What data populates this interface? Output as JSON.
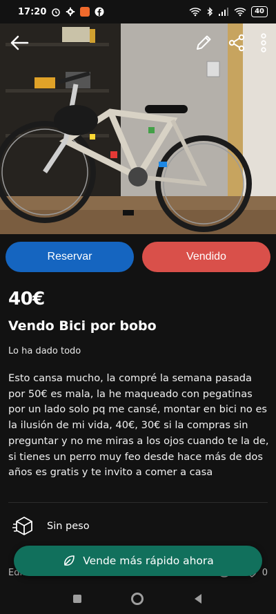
{
  "status_bar": {
    "time": "17:20",
    "battery": "40",
    "icons": [
      "alarm-icon",
      "gear-icon",
      "app-icon",
      "facebook-icon",
      "wifi-icon",
      "bluetooth-icon",
      "signal-icon",
      "wifi-icon",
      "battery-icon"
    ]
  },
  "header": {
    "back_icon": "arrow-left-icon",
    "edit_icon": "pencil-icon",
    "share_icon": "share-icon",
    "more_icon": "more-vertical-icon"
  },
  "actions": {
    "reserve_label": "Reservar",
    "sold_label": "Vendido",
    "reserve_color": "#1565c0",
    "sold_color": "#d9504a"
  },
  "listing": {
    "price": "40€",
    "title": "Vendo Bici por bobo",
    "condition": "Lo ha dado todo",
    "description": "Esto cansa mucho, la compré la semana pasada por 50€ es mala, la he maqueado con pegatinas por un lado solo pq me cansé, montar en bici no es la ilusión de mi vida, 40€, 30€ si la compras sin preguntar y no me miras a los ojos cuando te la de, si tienes un perro muy feo desde hace más de dos años es gratis y te invito a comer a casa"
  },
  "shipping": {
    "icon": "package-icon",
    "label": "Sin peso"
  },
  "footer": {
    "edited": "Editado hace más de 1 mes",
    "views": "0",
    "favorites": "0"
  },
  "promo": {
    "label": "Vende más rápido ahora",
    "icon": "leaf-icon",
    "color": "#11705c"
  },
  "nav": {
    "icons": [
      "square-icon",
      "circle-icon",
      "triangle-back-icon"
    ]
  }
}
